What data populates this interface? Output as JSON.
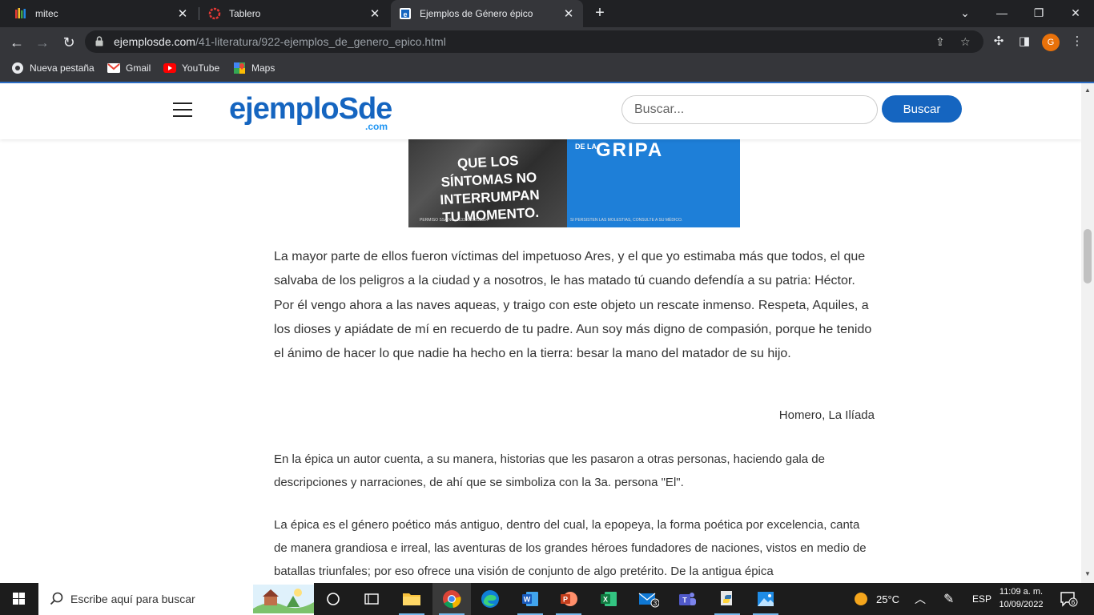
{
  "browser": {
    "tabs": [
      {
        "title": "mitec"
      },
      {
        "title": "Tablero"
      },
      {
        "title": "Ejemplos de Género épico"
      }
    ],
    "url_domain": "ejemplosde.com",
    "url_path": "/41-literatura/922-ejemplos_de_genero_epico.html",
    "profile_initial": "G",
    "bookmarks": [
      {
        "label": "Nueva pestaña"
      },
      {
        "label": "Gmail"
      },
      {
        "label": "YouTube"
      },
      {
        "label": "Maps"
      }
    ]
  },
  "site": {
    "logo_main": "ejemploSde",
    "logo_sub": ".com",
    "search_placeholder": "Buscar...",
    "search_button": "Buscar"
  },
  "ad": {
    "text_left": "QUE LOS SÍNTOMAS NO INTERRUMPAN TU MOMENTO.",
    "text_dela": "DE LA",
    "text_gripa": "GRIPA",
    "fine_left": "PERMISO SSA NO. 213300202C5854",
    "fine_right": "SI PERSISTEN LAS MOLESTIAS, CONSULTE A SU MÉDICO."
  },
  "article": {
    "quote": "La mayor parte de ellos fueron víctimas del impetuoso Ares, y el que yo estimaba más que todos, el que salvaba de los peligros a la ciudad y a nosotros, le has matado tú cuando defendía a su patria: Héctor. Por él vengo ahora a las naves aqueas, y traigo con este objeto un rescate inmenso. Respeta, Aquiles, a los dioses y apiádate de mí en recuerdo de tu padre. Aun soy más digno de compasión, porque he tenido el ánimo de hacer lo que nadie ha hecho en la tierra: besar la mano del matador de su hijo.",
    "citation": "Homero, La Ilíada",
    "paragraph_2": "En la épica un autor cuenta, a su manera, historias que les pasaron a otras personas, haciendo gala de descripciones y narraciones, de ahí que se simboliza con la 3a. persona \"El\".",
    "paragraph_3": "La épica es el género poético más antiguo, dentro del cual, la epopeya, la forma poética por excelencia, canta de manera grandiosa e irreal, las aventuras de los grandes héroes fundadores de naciones, vistos en medio de batallas triunfales; por eso ofrece una visión de conjunto de algo pretérito. De la antigua épica"
  },
  "taskbar": {
    "search_placeholder": "Escribe aquí para buscar",
    "weather": "25°C",
    "language": "ESP",
    "time": "11:09 a. m.",
    "date": "10/09/2022",
    "mail_badge": "3",
    "notification_count": "6"
  }
}
